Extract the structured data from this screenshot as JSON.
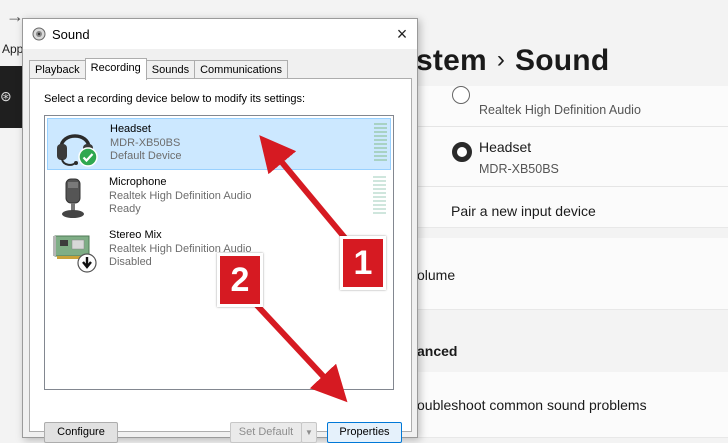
{
  "settings": {
    "back_glyph": "→",
    "app_label": "Apps",
    "breadcrumb_parent": "stem",
    "breadcrumb_sep": "›",
    "page_title": "Sound",
    "input_devices": [
      {
        "name": "",
        "subtitle": "Realtek High Definition Audio",
        "selected": false
      },
      {
        "name": "Headset",
        "subtitle": "MDR-XB50BS",
        "selected": true
      }
    ],
    "pair_new": "Pair a new input device",
    "volume_label": "olume",
    "advanced_label": "anced",
    "troubleshoot_label": "oubleshoot common sound problems"
  },
  "dialog": {
    "title": "Sound",
    "close_glyph": "×",
    "tabs": [
      {
        "label": "Playback",
        "active": false
      },
      {
        "label": "Recording",
        "active": true
      },
      {
        "label": "Sounds",
        "active": false
      },
      {
        "label": "Communications",
        "active": false
      }
    ],
    "instruction": "Select a recording device below to modify its settings:",
    "devices": [
      {
        "name": "Headset",
        "line2": "MDR-XB50BS",
        "line3": "Default Device",
        "icon": "headset-icon",
        "status_icon": "green-check-icon",
        "selected": true
      },
      {
        "name": "Microphone",
        "line2": "Realtek High Definition Audio",
        "line3": "Ready",
        "icon": "microphone-icon",
        "status_icon": "",
        "selected": false
      },
      {
        "name": "Stereo Mix",
        "line2": "Realtek High Definition Audio",
        "line3": "Disabled",
        "icon": "sound-card-icon",
        "status_icon": "disabled-arrow-icon",
        "selected": false
      }
    ],
    "buttons": {
      "configure": "Configure",
      "set_default": "Set Default",
      "dropdown_glyph": "▼",
      "properties": "Properties"
    }
  },
  "annotations": {
    "badge1": "1",
    "badge2": "2",
    "arrow_color": "#d61a22"
  },
  "colors": {
    "selection": "#cce8ff",
    "selection_border": "#99d1ff",
    "focus_blue": "#0078d7",
    "check_green": "#2fa84f",
    "annotation_red": "#d61a22"
  }
}
